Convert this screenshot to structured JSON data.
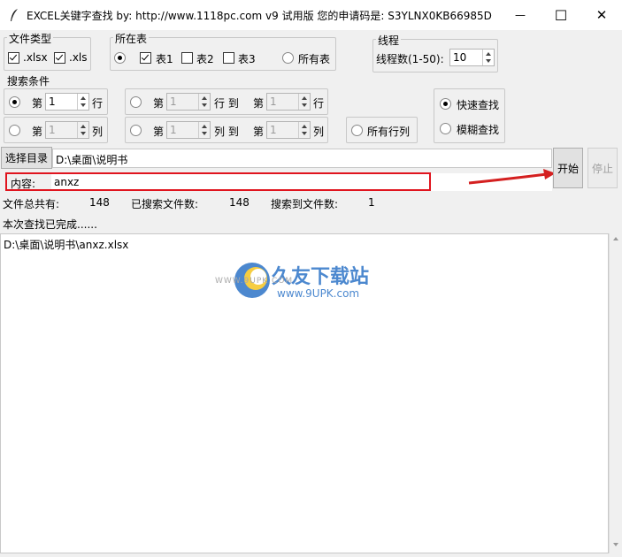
{
  "window": {
    "title": "EXCEL关键字查找  by: http://www.1118pc.com v9 试用版 您的申请码是: S3YLNX0KB66985D",
    "minimize": "—",
    "maximize": "☐",
    "close": "✕"
  },
  "file_type": {
    "label": "文件类型",
    "xlsx": {
      "label": ".xlsx",
      "checked": true
    },
    "xls": {
      "label": ".xls",
      "checked": true
    }
  },
  "sheet": {
    "label": "所在表",
    "sheet1": {
      "label": "表1",
      "checked": true
    },
    "sheet2": {
      "label": "表2",
      "checked": false
    },
    "sheet3": {
      "label": "表3",
      "checked": false
    },
    "all": {
      "label": "所有表"
    }
  },
  "threads": {
    "label": "线程",
    "count_label": "线程数(1-50):",
    "count_value": "10"
  },
  "search_conditions": {
    "label": "搜索条件",
    "row_option": {
      "prefix": "第",
      "value": "1",
      "suffix": "行"
    },
    "col_option": {
      "prefix": "第",
      "value": "1",
      "suffix": "列"
    },
    "row_range": {
      "prefix": "第",
      "from": "1",
      "mid": "行 到",
      "prefix2": "第",
      "to": "1",
      "suffix": "行"
    },
    "col_range": {
      "prefix": "第",
      "from": "1",
      "mid": "列 到",
      "prefix2": "第",
      "to": "1",
      "suffix": "列"
    },
    "all_rows_cols": "所有行列",
    "fast_search": "快速查找",
    "fuzzy_search": "模糊查找"
  },
  "directory": {
    "button": "选择目录",
    "path": "D:\\桌面\\说明书"
  },
  "content": {
    "label": "内容:",
    "value": "anxz"
  },
  "actions": {
    "start": "开始",
    "stop": "停止"
  },
  "stats": {
    "total_label": "文件总共有:",
    "total_value": "148",
    "searched_label": "已搜索文件数:",
    "searched_value": "148",
    "found_label": "搜索到文件数:",
    "found_value": "1"
  },
  "status": "本次查找已完成......",
  "results": [
    "D:\\桌面\\说明书\\anxz.xlsx"
  ],
  "watermark": {
    "brand": "久友下载站",
    "url_left": "WWW.9UPK.COM",
    "url_right": "www.9UPK.com"
  },
  "colors": {
    "highlight_box": "#e0141e",
    "arrow": "#d42020"
  }
}
